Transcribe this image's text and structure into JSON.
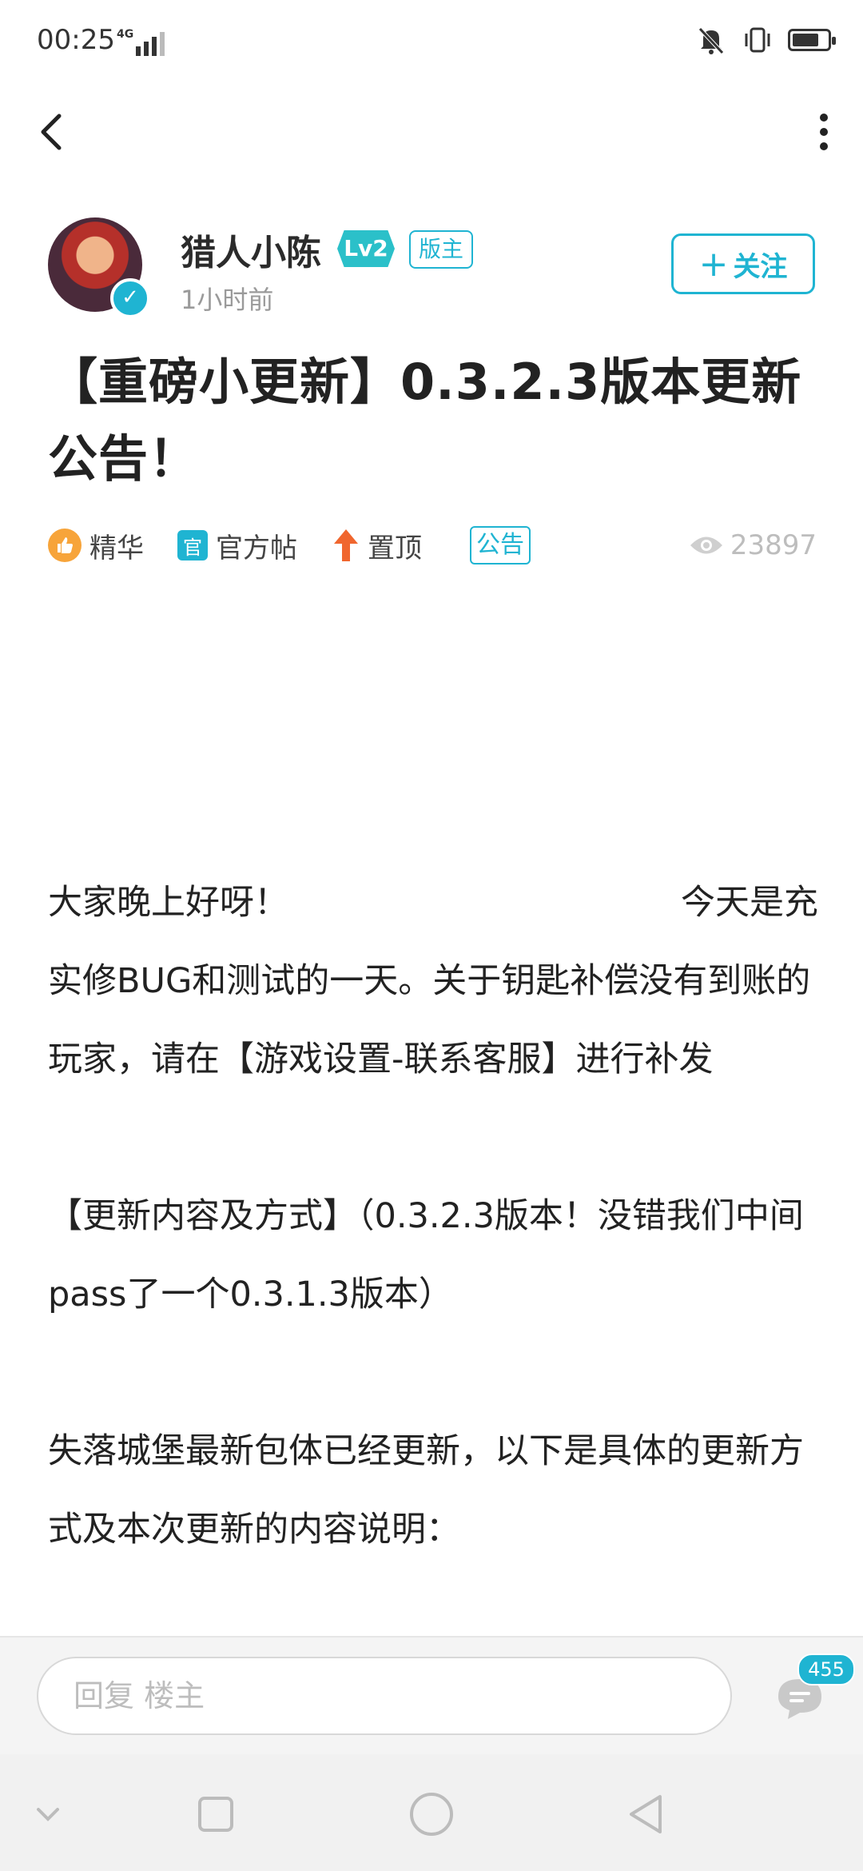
{
  "status_bar": {
    "time": "00:25",
    "network": "4G",
    "battery_level": 0.75
  },
  "toolbar": {
    "back_icon": "chevron-left-icon",
    "more_icon": "more-vertical-icon"
  },
  "author": {
    "name": "猎人小陈",
    "level": "Lv2",
    "role": "版主",
    "post_time": "1小时前",
    "follow_label": "关注",
    "follow_icon": "+"
  },
  "post": {
    "title": "【重磅小更新】0.3.2.3版本更新公告！",
    "tags": {
      "featured": "精华",
      "featured_icon": "thumbs-up-icon",
      "official": "官方帖",
      "official_icon_text": "官",
      "pinned": "置顶",
      "pinned_icon": "arrow-up-icon",
      "notice": "公告"
    },
    "views": "23897",
    "content": {
      "p1_start": "大家晚上好呀！",
      "p1_end": "今天是充",
      "p1_rest": "实修BUG和测试的一天。关于钥匙补偿没有到账的玩家，请在【游戏设置-联系客服】进行补发",
      "p2": "【更新内容及方式】（0.3.2.3版本！没错我们中间pass了一个0.3.1.3版本）",
      "p3": "失落城堡最新包体已经更新，以下是具体的更新方式及本次更新的内容说明："
    }
  },
  "reply_bar": {
    "placeholder": "回复  楼主",
    "comment_count": "455"
  },
  "colors": {
    "accent": "#1fb4d2",
    "featured": "#f7a43a",
    "pinned": "#f0662e"
  }
}
